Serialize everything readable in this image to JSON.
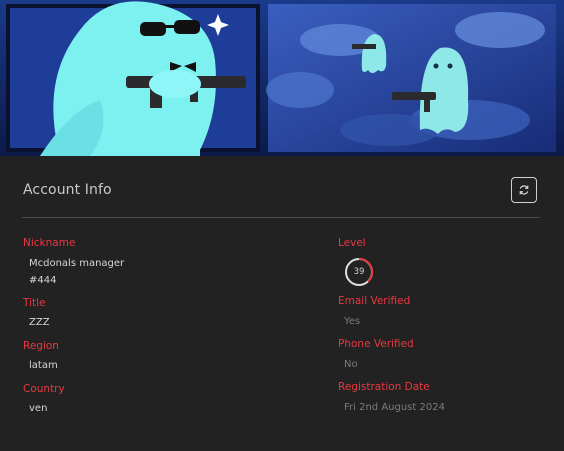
{
  "header": {
    "title": "Account Info",
    "refresh_icon": "refresh-icon"
  },
  "fields": {
    "nickname": {
      "label": "Nickname",
      "value": "Mcdonals manager",
      "tag": "#444"
    },
    "title": {
      "label": "Title",
      "value": "ZZZ"
    },
    "region": {
      "label": "Region",
      "value": "latam"
    },
    "country": {
      "label": "Country",
      "value": "ven"
    },
    "level": {
      "label": "Level",
      "value": "39"
    },
    "email_verified": {
      "label": "Email Verified",
      "value": "Yes"
    },
    "phone_verified": {
      "label": "Phone Verified",
      "value": "No"
    },
    "registration_date": {
      "label": "Registration Date",
      "value": "Fri 2nd August 2024"
    }
  },
  "colors": {
    "accent": "#e8383f",
    "panel": "#232223",
    "text": "#d6d6d6",
    "muted": "#7b7b7b"
  }
}
